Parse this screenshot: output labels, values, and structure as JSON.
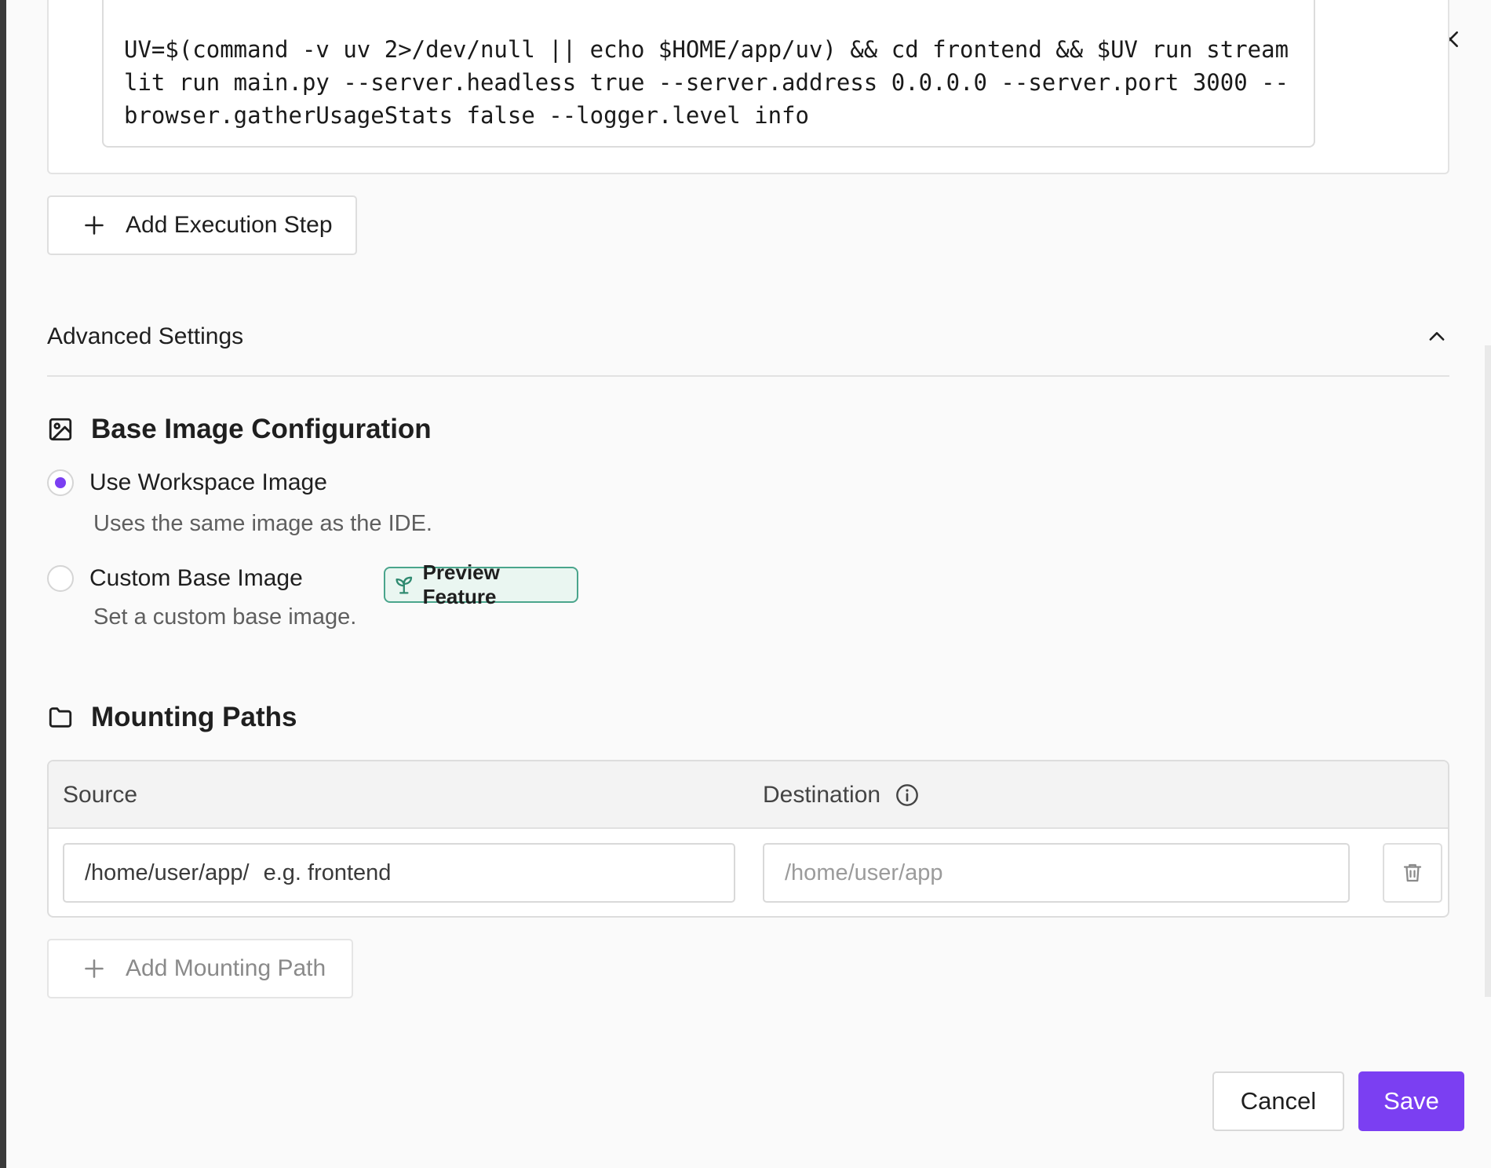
{
  "command": {
    "text": "UV=$(command -v uv 2>/dev/null || echo $HOME/app/uv) && cd frontend && $UV run streamlit run main.py --server.headless true --server.address 0.0.0.0 --server.port 3000 --browser.gatherUsageStats false --logger.level info"
  },
  "add_execution_step_label": "Add Execution Step",
  "advanced_settings": {
    "label": "Advanced Settings",
    "expanded": true
  },
  "base_image": {
    "heading": "Base Image Configuration",
    "options": [
      {
        "label": "Use Workspace Image",
        "description": "Uses the same image as the IDE.",
        "selected": true
      },
      {
        "label": "Custom Base Image",
        "description": "Set a custom base image.",
        "selected": false
      }
    ],
    "badge_label": "Preview Feature"
  },
  "mounting_paths": {
    "heading": "Mounting Paths",
    "columns": {
      "source": "Source",
      "destination": "Destination"
    },
    "rows": [
      {
        "source_prefix": "/home/user/app/",
        "source_placeholder": "e.g. frontend",
        "destination_placeholder": "/home/user/app"
      }
    ],
    "add_label": "Add Mounting Path"
  },
  "footer": {
    "cancel_label": "Cancel",
    "save_label": "Save"
  },
  "colors": {
    "accent": "#7b3ff2",
    "badge_border": "#4aa58c",
    "badge_bg": "#eaf6f1"
  },
  "icons": {
    "close": "close-icon",
    "plus": "plus-icon",
    "chevron": "chevron-up-icon",
    "image": "image-icon",
    "sprout": "sprout-icon",
    "folder": "folder-icon",
    "info": "info-icon",
    "trash": "trash-icon"
  }
}
